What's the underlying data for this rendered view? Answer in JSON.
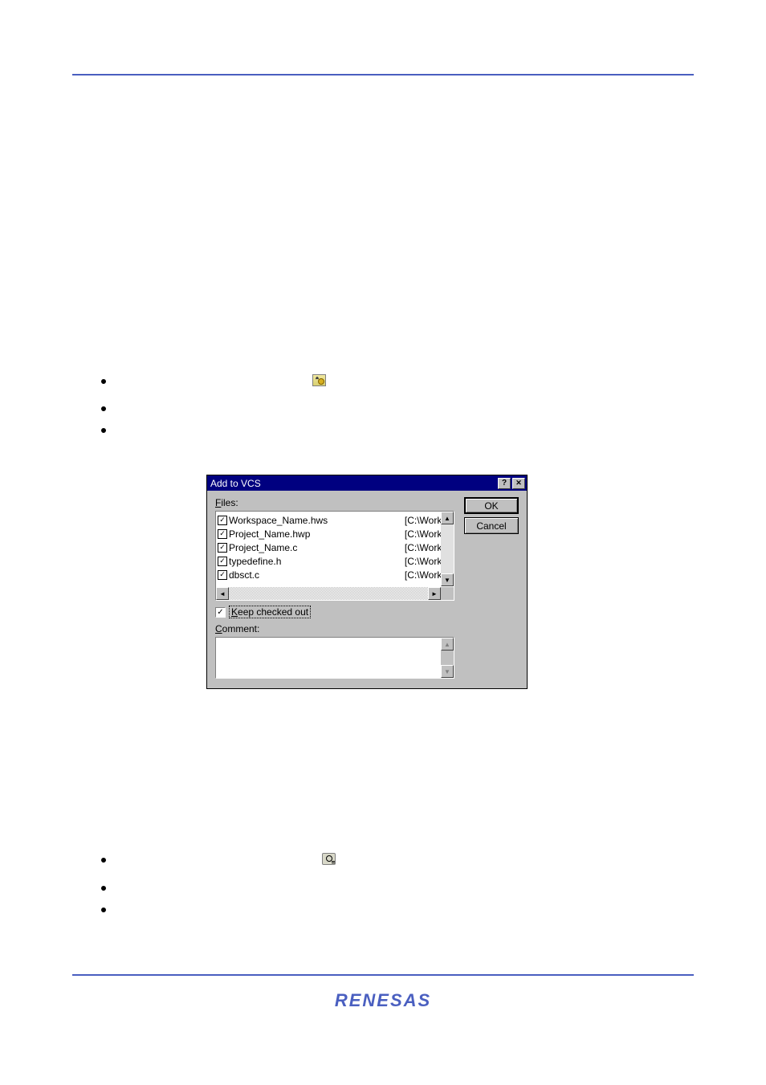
{
  "dialog": {
    "title": "Add to VCS",
    "files_label": "Files:",
    "ok_label": "OK",
    "cancel_label": "Cancel",
    "keep_label": "Keep checked out",
    "comment_label": "Comment:",
    "files": [
      {
        "name": "Workspace_Name.hws",
        "path": "[C:\\Worksp"
      },
      {
        "name": "Project_Name.hwp",
        "path": "[C:\\Worksp"
      },
      {
        "name": "Project_Name.c",
        "path": "[C:\\Worksp"
      },
      {
        "name": "typedefine.h",
        "path": "[C:\\Worksp"
      },
      {
        "name": "dbsct.c",
        "path": "[C:\\Worksp"
      }
    ]
  },
  "logo_text": "RENESAS"
}
